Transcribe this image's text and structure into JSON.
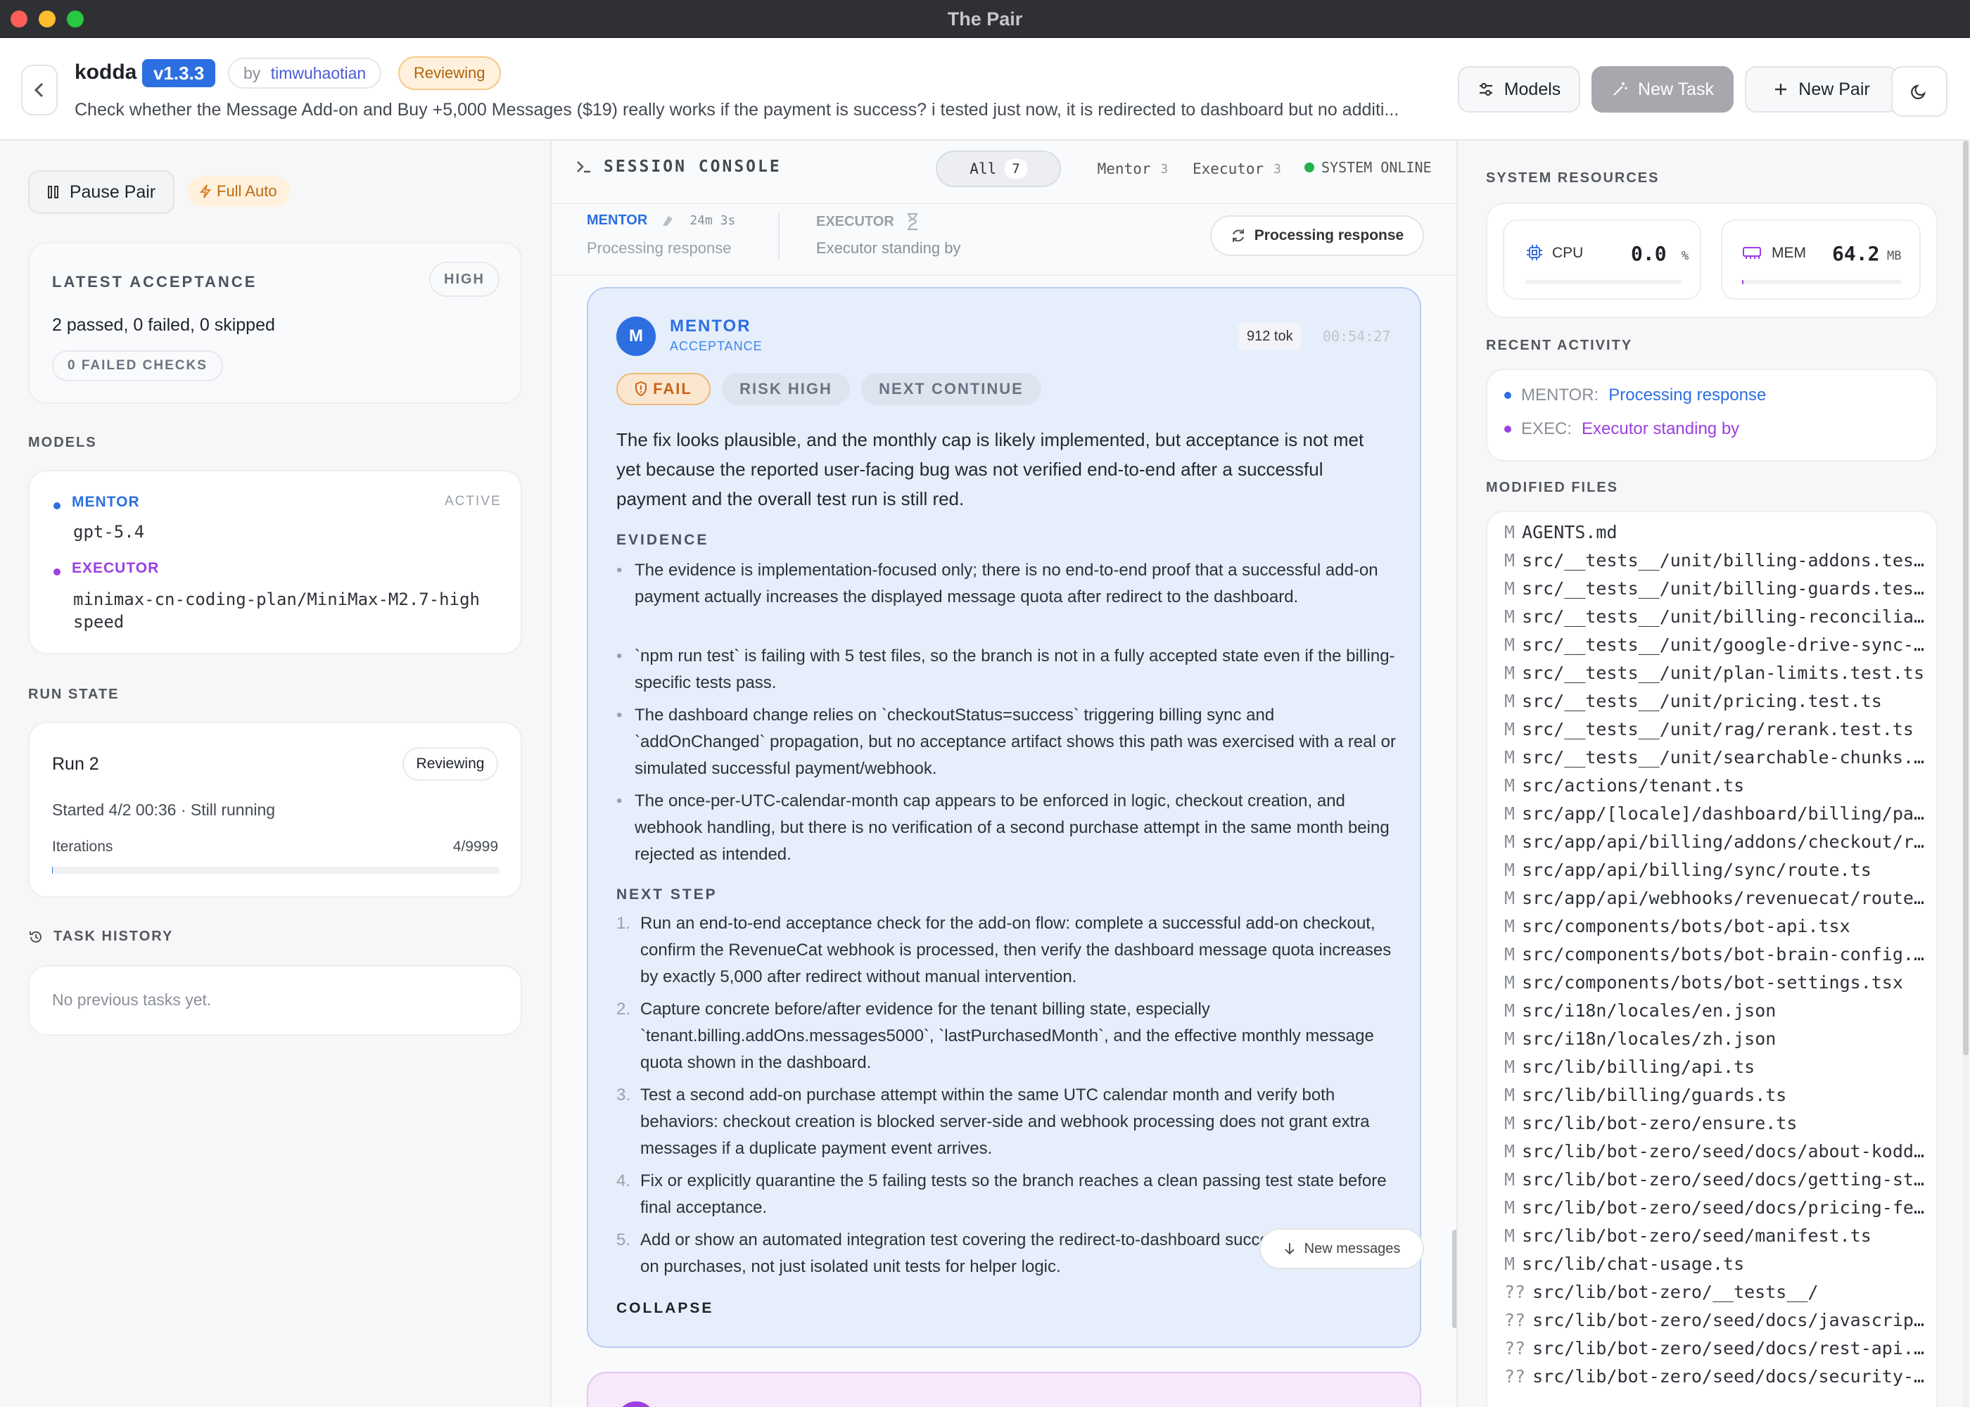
{
  "window": {
    "title": "The Pair"
  },
  "header": {
    "app": "kodda",
    "version": "v1.3.3",
    "by": "by",
    "author": "timwuhaotian",
    "status": "Reviewing",
    "task": "Check whether the Message Add-on and Buy +5,000 Messages ($19) really works if the payment is success? i tested just now, it is redirected to dashboard but no additi...",
    "models_btn": "Models",
    "new_task_btn": "New Task",
    "new_pair_btn": "New Pair"
  },
  "left": {
    "pause": "Pause Pair",
    "full_auto": "Full Auto",
    "acceptance": {
      "title": "LATEST ACCEPTANCE",
      "level": "HIGH",
      "summary": "2 passed, 0 failed, 0 skipped",
      "failed": "0 FAILED CHECKS"
    },
    "models_title": "MODELS",
    "mentor": {
      "label": "MENTOR",
      "state": "ACTIVE",
      "model": "gpt-5.4"
    },
    "executor": {
      "label": "EXECUTOR",
      "model": "minimax-cn-coding-plan/MiniMax-M2.7-highspeed"
    },
    "run_title": "RUN STATE",
    "run": {
      "name": "Run 2",
      "status": "Reviewing",
      "started": "Started 4/2 00:36 · Still running",
      "iter_label": "Iterations",
      "iter_value": "4/9999",
      "progress": 0.0004
    },
    "history_title": "TASK HISTORY",
    "history_empty": "No previous tasks yet."
  },
  "console": {
    "title": "SESSION CONSOLE",
    "filters": [
      {
        "label": "All",
        "count": "7"
      },
      {
        "label": "Mentor",
        "count": "3"
      },
      {
        "label": "Executor",
        "count": "3"
      }
    ],
    "online": "SYSTEM ONLINE",
    "mentor": {
      "label": "MENTOR",
      "time": "24m 3s",
      "status": "Processing response"
    },
    "executor": {
      "label": "EXECUTOR",
      "status": "Executor standing by"
    },
    "processing": "Processing response",
    "message": {
      "avatar": "M",
      "role": "MENTOR",
      "sub": "ACCEPTANCE",
      "tokens": "912 tok",
      "time": "00:54:27",
      "chips": [
        "FAIL",
        "RISK HIGH",
        "NEXT CONTINUE"
      ],
      "summary": "The fix looks plausible, and the monthly cap is likely implemented, but acceptance is not met yet because the reported user-facing bug was not verified end-to-end after a successful payment and the overall test run is still red.",
      "evidence_title": "EVIDENCE",
      "evidence": [
        "The evidence is implementation-focused only; there is no end-to-end proof that a successful add-on payment actually increases the displayed message quota after redirect to the dashboard.",
        "`npm run test` is failing with 5 test files, so the branch is not in a fully accepted state even if the billing-specific tests pass.",
        "The dashboard change relies on `checkoutStatus=success` triggering billing sync and `addOnChanged` propagation, but no acceptance artifact shows this path was exercised with a real or simulated successful payment/webhook.",
        "The once-per-UTC-calendar-month cap appears to be enforced in logic, checkout creation, and webhook handling, but there is no verification of a second purchase attempt in the same month being rejected as intended."
      ],
      "next_title": "NEXT STEP",
      "next": [
        "Run an end-to-end acceptance check for the add-on flow: complete a successful add-on checkout, confirm the RevenueCat webhook is processed, then verify the dashboard message quota increases by exactly 5,000 after redirect without manual intervention.",
        "Capture concrete before/after evidence for the tenant billing state, especially `tenant.billing.addOns.messages5000`, `lastPurchasedMonth`, and the effective monthly message quota shown in the dashboard.",
        "Test a second add-on purchase attempt within the same UTC calendar month and verify both behaviors: checkout creation is blocked server-side and webhook processing does not grant extra messages if a duplicate payment event arrives.",
        "Fix or explicitly quarantine the 5 failing tests so the branch reaches a clean passing test state before final acceptance.",
        "Add or show an automated integration test covering the redirect-to-dashboard success path for add-on purchases, not just isolated unit tests for helper logic."
      ],
      "collapse": "COLLAPSE"
    },
    "new_messages": "New messages"
  },
  "right": {
    "resources_title": "SYSTEM RESOURCES",
    "cpu": {
      "label": "CPU",
      "value": "0.0",
      "unit": "%",
      "level": 0.0
    },
    "mem": {
      "label": "MEM",
      "value": "64.2",
      "unit": "MB",
      "level": 0.01
    },
    "activity_title": "RECENT ACTIVITY",
    "activity": [
      {
        "who": "MENTOR:",
        "what": "Processing response"
      },
      {
        "who": "EXEC:",
        "what": "Executor standing by"
      }
    ],
    "files_title": "MODIFIED FILES",
    "files": [
      {
        "s": "M",
        "p": "AGENTS.md"
      },
      {
        "s": "M",
        "p": "src/__tests__/unit/billing-addons.test.ts"
      },
      {
        "s": "M",
        "p": "src/__tests__/unit/billing-guards.test.ts"
      },
      {
        "s": "M",
        "p": "src/__tests__/unit/billing-reconciliation.test.ts"
      },
      {
        "s": "M",
        "p": "src/__tests__/unit/google-drive-sync-worker.test.ts"
      },
      {
        "s": "M",
        "p": "src/__tests__/unit/plan-limits.test.ts"
      },
      {
        "s": "M",
        "p": "src/__tests__/unit/pricing.test.ts"
      },
      {
        "s": "M",
        "p": "src/__tests__/unit/rag/rerank.test.ts"
      },
      {
        "s": "M",
        "p": "src/__tests__/unit/searchable-chunks.test.ts"
      },
      {
        "s": "M",
        "p": "src/actions/tenant.ts"
      },
      {
        "s": "M",
        "p": "src/app/[locale]/dashboard/billing/page.tsx"
      },
      {
        "s": "M",
        "p": "src/app/api/billing/addons/checkout/route.ts"
      },
      {
        "s": "M",
        "p": "src/app/api/billing/sync/route.ts"
      },
      {
        "s": "M",
        "p": "src/app/api/webhooks/revenuecat/route.ts"
      },
      {
        "s": "M",
        "p": "src/components/bots/bot-api.tsx"
      },
      {
        "s": "M",
        "p": "src/components/bots/bot-brain-config.tsx"
      },
      {
        "s": "M",
        "p": "src/components/bots/bot-settings.tsx"
      },
      {
        "s": "M",
        "p": "src/i18n/locales/en.json"
      },
      {
        "s": "M",
        "p": "src/i18n/locales/zh.json"
      },
      {
        "s": "M",
        "p": "src/lib/billing/api.ts"
      },
      {
        "s": "M",
        "p": "src/lib/billing/guards.ts"
      },
      {
        "s": "M",
        "p": "src/lib/bot-zero/ensure.ts"
      },
      {
        "s": "M",
        "p": "src/lib/bot-zero/seed/docs/about-kodda.md"
      },
      {
        "s": "M",
        "p": "src/lib/bot-zero/seed/docs/getting-started.md"
      },
      {
        "s": "M",
        "p": "src/lib/bot-zero/seed/docs/pricing-features.md"
      },
      {
        "s": "M",
        "p": "src/lib/bot-zero/seed/manifest.ts"
      },
      {
        "s": "M",
        "p": "src/lib/chat-usage.ts"
      },
      {
        "s": "??",
        "p": "src/lib/bot-zero/__tests__/"
      },
      {
        "s": "??",
        "p": "src/lib/bot-zero/seed/docs/javascript-sdk.md"
      },
      {
        "s": "??",
        "p": "src/lib/bot-zero/seed/docs/rest-api.md"
      },
      {
        "s": "??",
        "p": "src/lib/bot-zero/seed/docs/security-privacy.md"
      }
    ]
  }
}
